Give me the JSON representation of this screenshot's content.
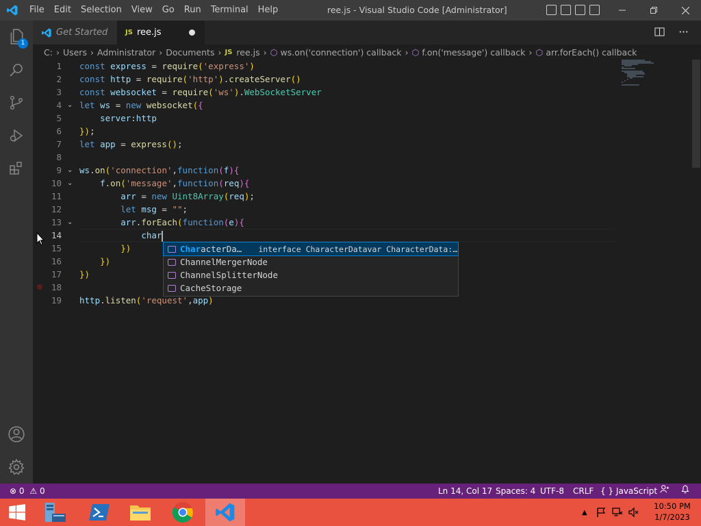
{
  "window": {
    "title": "ree.js - Visual Studio Code [Administrator]",
    "menu": [
      "File",
      "Edit",
      "Selection",
      "View",
      "Go",
      "Run",
      "Terminal",
      "Help"
    ]
  },
  "activity": {
    "explorer_badge": "1"
  },
  "tabs": [
    {
      "label": "Get Started",
      "active": false
    },
    {
      "label": "ree.js",
      "active": true,
      "dirty": true
    }
  ],
  "tab_file_type": "JS",
  "breadcrumb": [
    "C:",
    "Users",
    "Administrator",
    "Documents",
    "ree.js",
    "ws.on('connection') callback",
    "f.on('message') callback",
    "arr.forEach() callback"
  ],
  "code": {
    "current_line": 14,
    "lines": [
      "const express = require('express')",
      "const http = require('http').createServer()",
      "const websocket = require('ws').WebSocketServer",
      "let ws = new websocket({",
      "    server:http",
      "});",
      "let app = express();",
      "",
      "ws.on('connection',function(f){",
      "    f.on('message',function(req){",
      "        arr = new Uint8Array(req);",
      "        let msg = \"\";",
      "        arr.forEach(function(e){",
      "            char",
      "        })",
      "    })",
      "})",
      "",
      "http.listen('request',app)"
    ]
  },
  "suggestions": [
    {
      "label": "CharacterDa…",
      "detail": "interface CharacterDatavar CharacterData:…",
      "selected": true
    },
    {
      "label": "ChannelMergerNode",
      "detail": "",
      "selected": false
    },
    {
      "label": "ChannelSplitterNode",
      "detail": "",
      "selected": false
    },
    {
      "label": "CacheStorage",
      "detail": "",
      "selected": false
    }
  ],
  "status": {
    "errors": "0",
    "warnings": "0",
    "position": "Ln 14, Col 17",
    "spaces": "Spaces: 4",
    "encoding": "UTF-8",
    "eol": "CRLF",
    "language_braces": "{ }",
    "language": "JavaScript"
  },
  "taskbar": {
    "time": "10:50 PM",
    "date": "1/7/2023"
  },
  "colors": {
    "statusbar": "#68217a",
    "taskbar": "#e8523f",
    "accent": "#0078d4"
  }
}
